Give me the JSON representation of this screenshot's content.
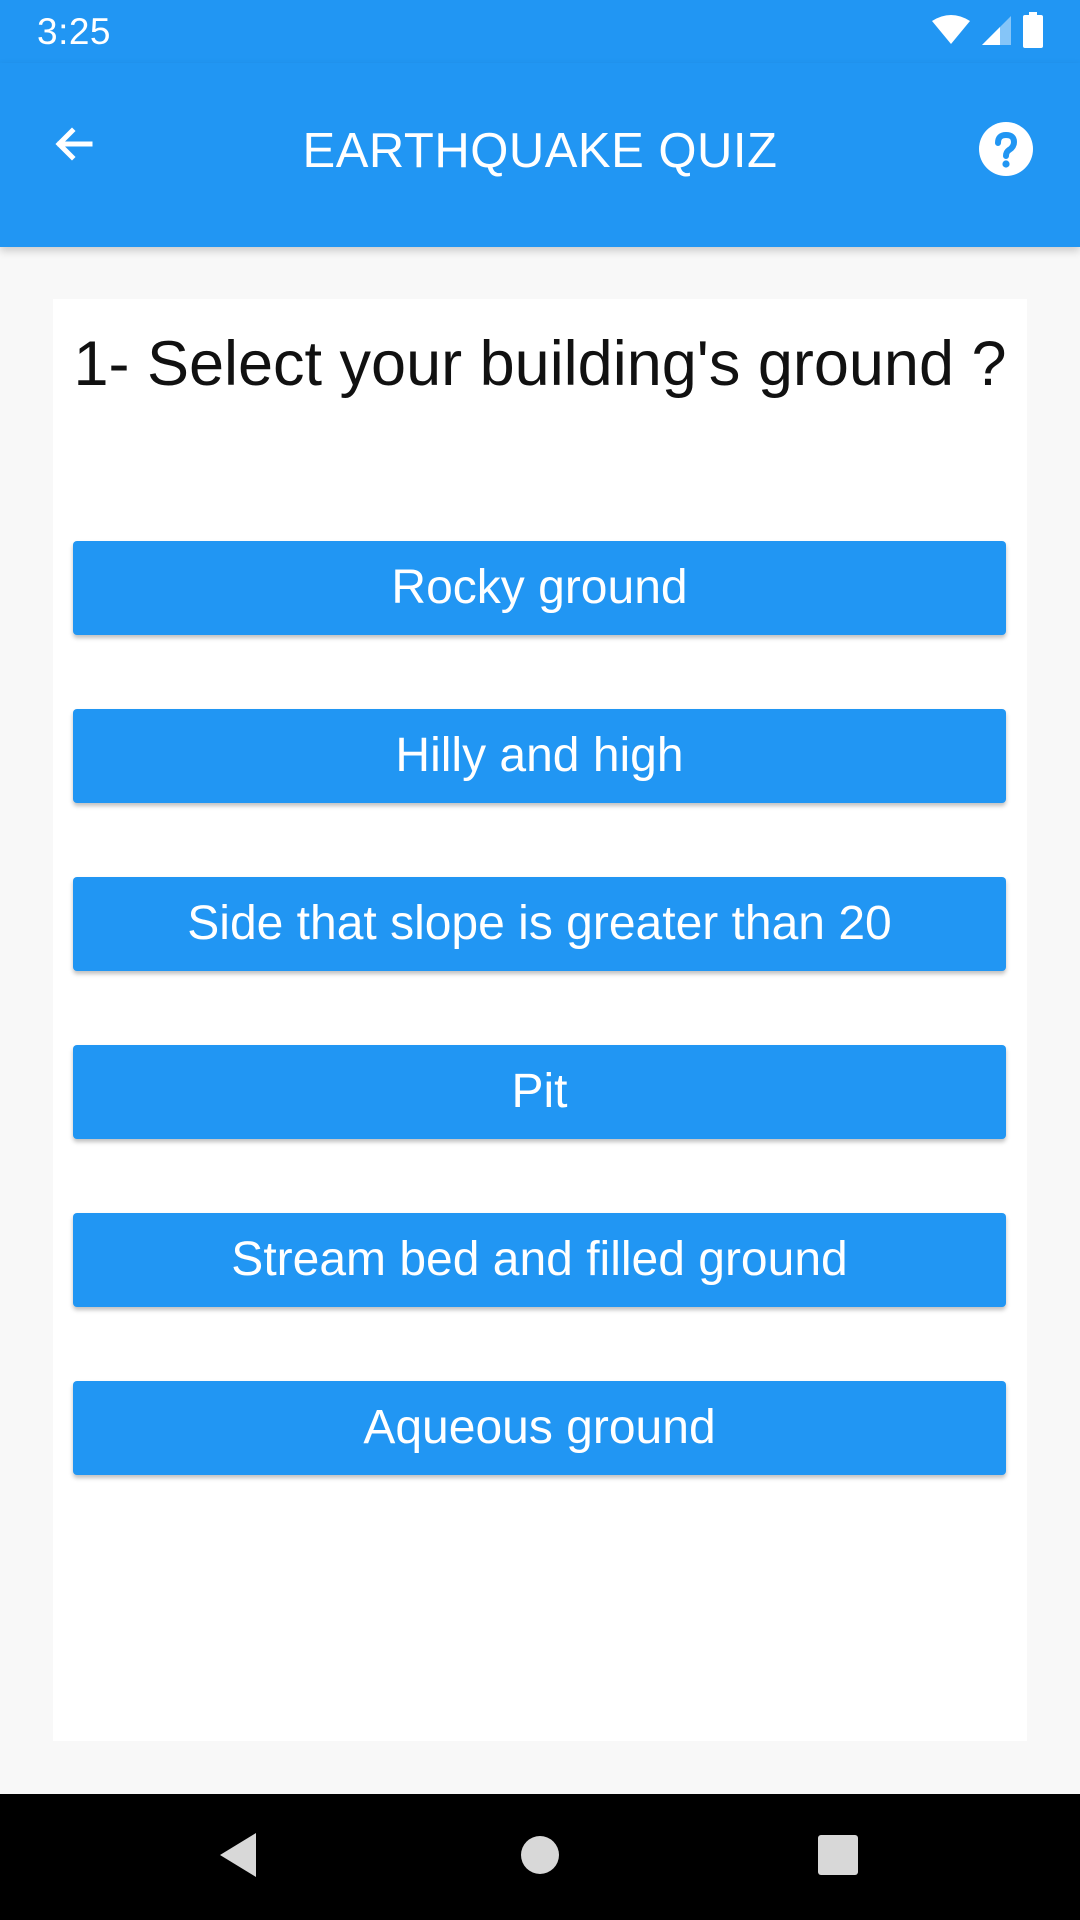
{
  "status_bar": {
    "time": "3:25",
    "icons": [
      "wifi-icon",
      "cell-signal-icon",
      "battery-icon"
    ]
  },
  "app_bar": {
    "title": "EARTHQUAKE QUIZ",
    "back_icon": "arrow-back-icon",
    "help_icon": "help-circle-icon"
  },
  "quiz": {
    "question": "1- Select your building's ground ?",
    "options": [
      "Rocky ground",
      "Hilly and high",
      "Side that slope is greater than 20",
      "Pit",
      "Stream bed and filled ground",
      "Aqueous ground"
    ]
  },
  "nav_bar": {
    "icons": [
      "nav-back-icon",
      "nav-home-icon",
      "nav-recents-icon"
    ]
  },
  "colors": {
    "primary": "#2196f3",
    "background": "#f8f8f8",
    "card": "#ffffff",
    "nav_bar": "#000000"
  }
}
